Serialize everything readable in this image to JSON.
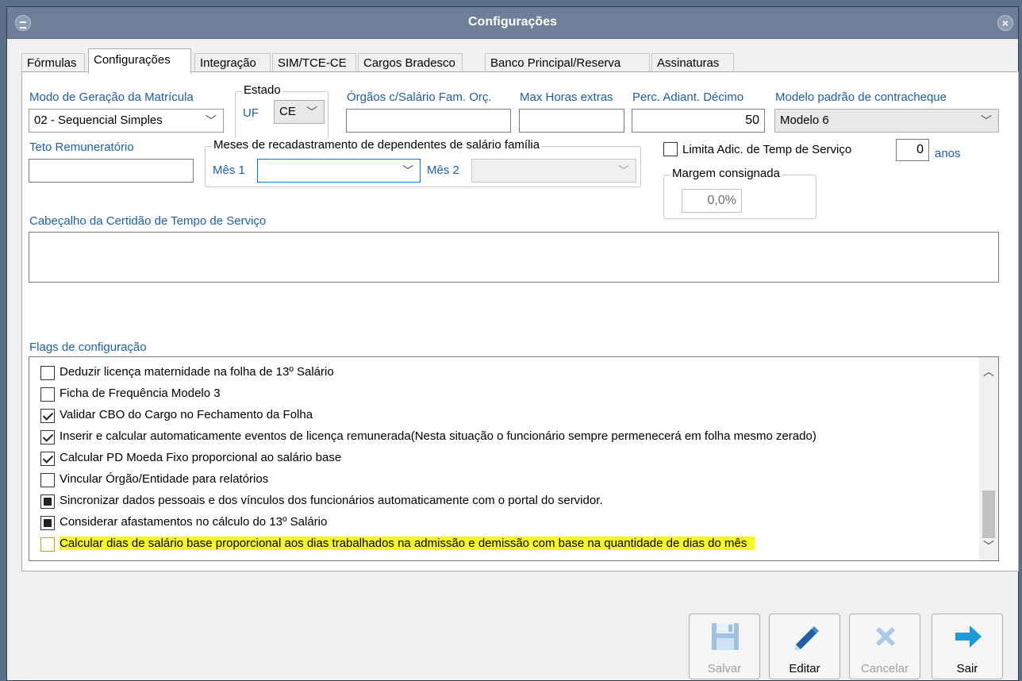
{
  "window": {
    "title": "Configurações"
  },
  "tabs": [
    {
      "label": "Fórmulas"
    },
    {
      "label": "Configurações"
    },
    {
      "label": "Integração"
    },
    {
      "label": "SIM/TCE-CE"
    },
    {
      "label": "Cargos Bradesco"
    },
    {
      "label": "Banco Principal/Reserva"
    },
    {
      "label": "Assinaturas"
    }
  ],
  "form": {
    "modo_label": "Modo de Geração da Matrícula",
    "modo_value": "02 - Sequencial Simples",
    "estado_legend": "Estado",
    "uf_label": "UF",
    "uf_value": "CE",
    "orgaos_label": "Órgãos c/Salário Fam. Orç.",
    "orgaos_value": "",
    "max_horas_label": "Max Horas extras",
    "max_horas_value": "",
    "perc_label": "Perc. Adiant. Décimo",
    "perc_value": "50",
    "modelo_label": "Modelo padrão de contracheque",
    "modelo_value": "Modelo 6",
    "teto_label": "Teto Remuneratório",
    "teto_value": "",
    "meses_legend": "Meses de recadastramento de dependentes de salário família",
    "mes1_label": "Mês 1",
    "mes1_value": "",
    "mes2_label": "Mês 2",
    "mes2_value": "",
    "limita_label": "Limita Adic. de Temp de Serviço",
    "limita_checked": false,
    "anos_value": "0",
    "anos_label": "anos",
    "margem_legend": "Margem consignada",
    "margem_value": "0,0%",
    "cabecalho_label": "Cabeçalho da Certidão de Tempo de Serviço",
    "cabecalho_value": "",
    "flags_label": "Flags de configuração"
  },
  "flags": [
    {
      "label": "Deduzir licença maternidade na folha de 13º Salário",
      "state": "unchecked"
    },
    {
      "label": "Ficha de Frequência Modelo 3",
      "state": "unchecked"
    },
    {
      "label": "Validar CBO do Cargo no Fechamento da Folha",
      "state": "checked"
    },
    {
      "label": "Inserir e calcular automaticamente eventos de licença remunerada(Nesta situação o funcionário sempre permenecerá em folha mesmo zerado)",
      "state": "checked"
    },
    {
      "label": "Calcular PD Moeda Fixo proporcional ao salário base",
      "state": "checked"
    },
    {
      "label": "Vincular Órgão/Entidade para relatórios",
      "state": "unchecked"
    },
    {
      "label": "Sincronizar dados pessoais e dos vínculos dos funcionários automaticamente com o portal do servidor.",
      "state": "indeterminate"
    },
    {
      "label": "Considerar afastamentos no cálculo do 13º Salário",
      "state": "indeterminate"
    },
    {
      "label": "Calcular dias de salário base proporcional aos dias trabalhados na admissão e demissão com base na quantidade de dias do mês",
      "state": "unchecked",
      "highlighted": true
    }
  ],
  "buttons": {
    "salvar": "Salvar",
    "editar": "Editar",
    "cancelar": "Cancelar",
    "sair": "Sair"
  },
  "colors": {
    "titlebar": "#6e8098",
    "label_blue": "#1a5fb4",
    "highlight": "#f6f91b",
    "disk_icon": "#9fc2e4",
    "pencil_icon": "#1f5fa8",
    "arrow_icon": "#1e9ad6"
  }
}
